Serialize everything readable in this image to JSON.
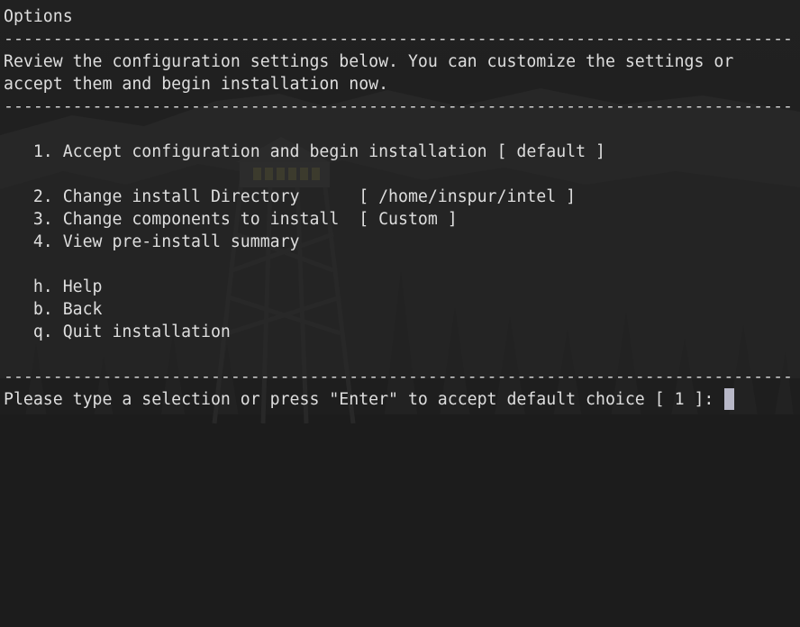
{
  "window": {
    "title": "Options"
  },
  "separator": "--------------------------------------------------------------------------------",
  "intro": {
    "line1": "Review the configuration settings below. You can customize the settings or",
    "line2": "accept them and begin installation now."
  },
  "menu": {
    "item1": "   1. Accept configuration and begin installation [ default ]",
    "item2": "   2. Change install Directory      [ /home/inspur/intel ]",
    "item3": "   3. Change components to install  [ Custom ]",
    "item4": "   4. View pre-install summary",
    "help": "   h. Help",
    "back": "   b. Back",
    "quit": "   q. Quit installation"
  },
  "prompt": {
    "text": "Please type a selection or press \"Enter\" to accept default choice [ 1 ]: ",
    "cursor_color": "#b8b8c8"
  },
  "theme": {
    "background": "#1e1e1e",
    "foreground": "#dedede",
    "wallpaper": "dark forest with fire lookout tower"
  }
}
